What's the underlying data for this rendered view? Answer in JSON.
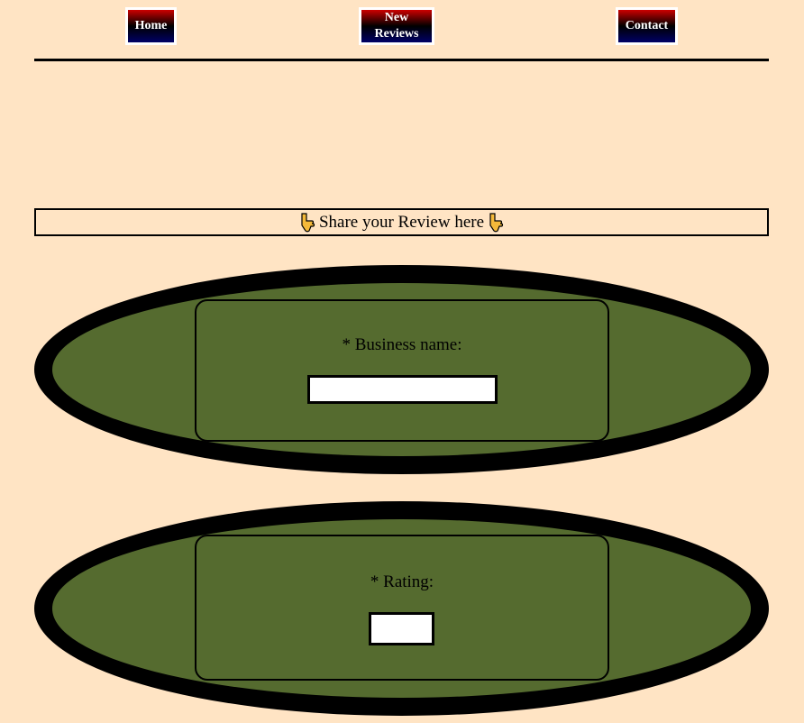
{
  "nav": {
    "home": "Home",
    "new_reviews": "New Reviews",
    "contact": "Contact"
  },
  "banner": {
    "text": "Share your Review here",
    "icon": "hand-pointing-down-icon"
  },
  "form": {
    "business_name": {
      "label": "* Business name:",
      "value": ""
    },
    "rating": {
      "label": "* Rating:",
      "value": ""
    }
  },
  "colors": {
    "background": "#ffe4c4",
    "oval_border": "#000000",
    "oval_fill": "#556b2f",
    "nav_gradient_top": "#cc0000",
    "nav_gradient_bottom": "#000066"
  }
}
